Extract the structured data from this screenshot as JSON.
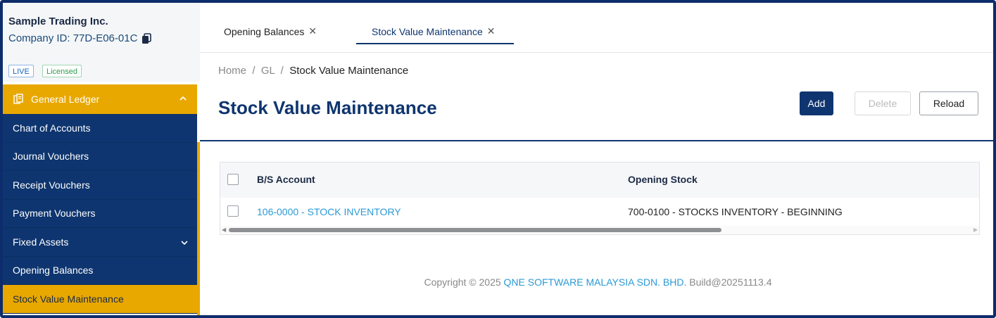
{
  "company": {
    "name": "Sample Trading Inc.",
    "id_label": "Company ID: 77D-E06-01C"
  },
  "badges": {
    "live": "LIVE",
    "licensed": "Licensed"
  },
  "sidebar": {
    "group": {
      "label": "General Ledger"
    },
    "items": [
      {
        "label": "Chart of Accounts"
      },
      {
        "label": "Journal Vouchers"
      },
      {
        "label": "Receipt Vouchers"
      },
      {
        "label": "Payment Vouchers"
      },
      {
        "label": "Fixed Assets"
      },
      {
        "label": "Opening Balances"
      },
      {
        "label": "Stock Value Maintenance"
      }
    ]
  },
  "tabs": [
    {
      "label": "Opening Balances",
      "close": "✕"
    },
    {
      "label": "Stock Value Maintenance",
      "close": "✕"
    }
  ],
  "breadcrumb": {
    "home": "Home",
    "sep": "/",
    "gl": "GL",
    "current": "Stock Value Maintenance"
  },
  "page": {
    "title": "Stock Value Maintenance"
  },
  "toolbar": {
    "add": "Add",
    "delete": "Delete",
    "reload": "Reload"
  },
  "table": {
    "columns": [
      "B/S Account",
      "Opening Stock"
    ],
    "rows": [
      {
        "bs_account": "106-0000 - STOCK INVENTORY",
        "opening_stock": "700-0100 - STOCKS INVENTORY - BEGINNING"
      }
    ]
  },
  "footer": {
    "prefix": "Copyright © 2025",
    "company": "QNE SOFTWARE MALAYSIA SDN. BHD.",
    "build": "Build@20251113.4"
  },
  "colors": {
    "navy": "#0e356f",
    "accent": "#e8a800",
    "link": "#2a9ad6"
  }
}
